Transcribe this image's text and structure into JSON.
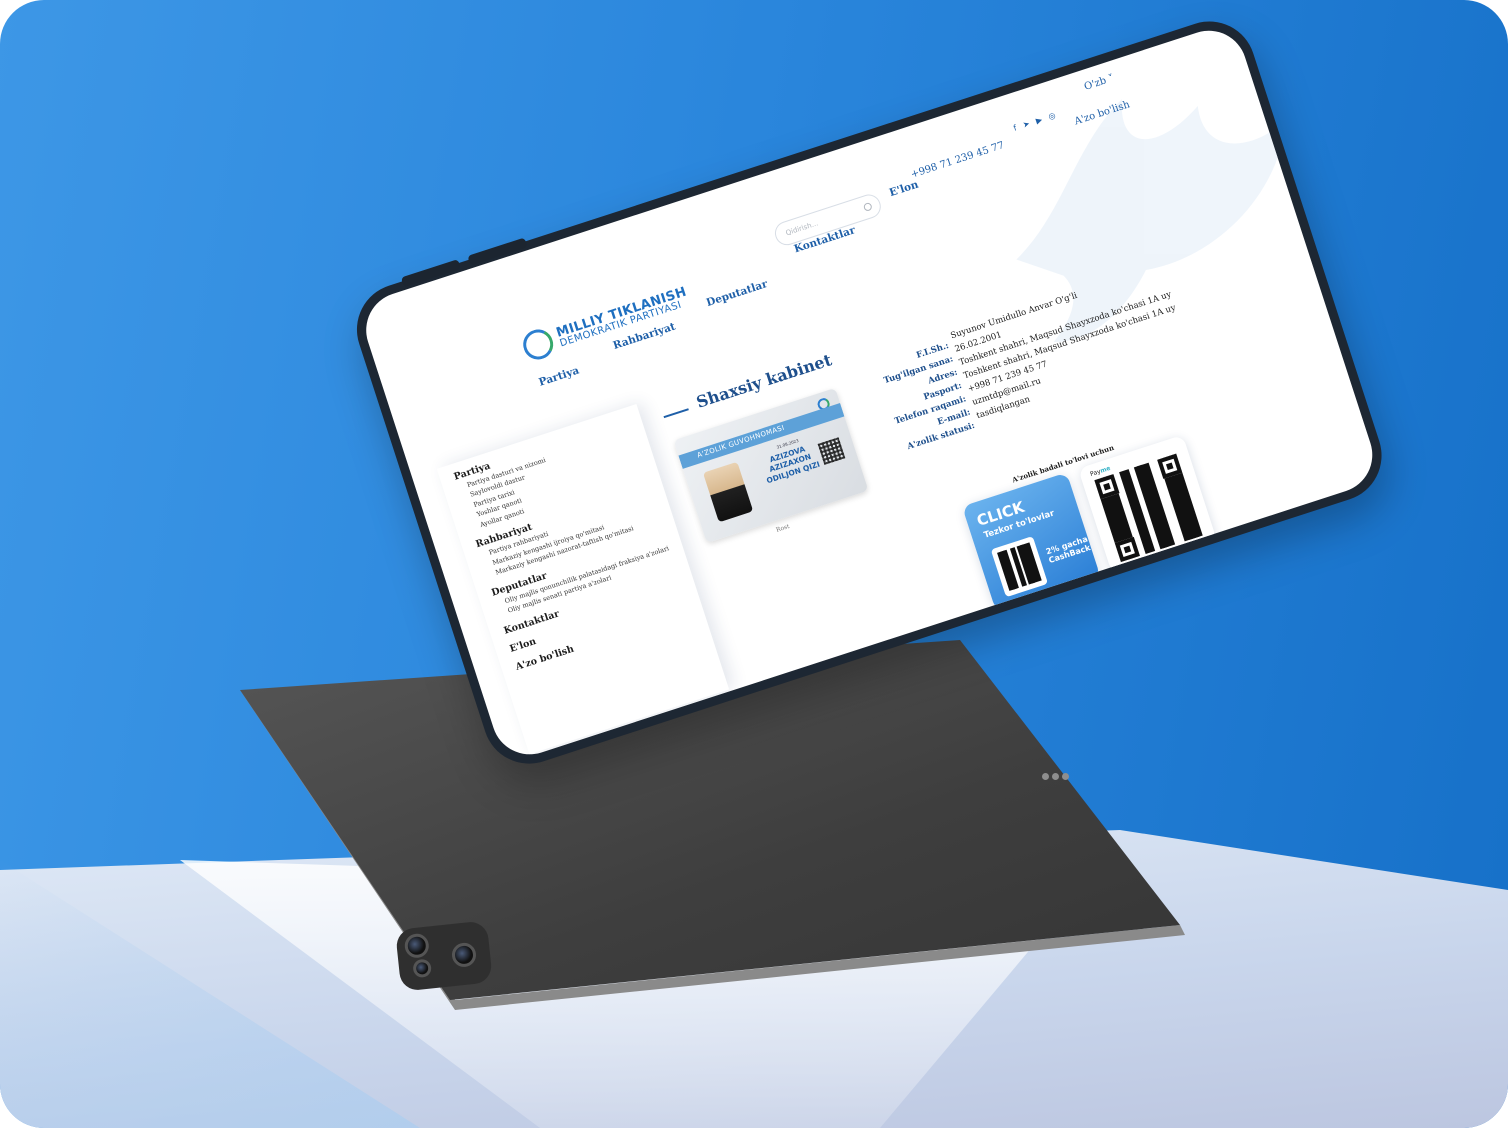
{
  "header": {
    "logo_line1": "MILLIY TIKLANISH",
    "logo_line2": "DEMOKRATIK PARTIYASI",
    "search_placeholder": "Qidirish...",
    "phone": "+998 71 239 45 77",
    "language": "O'zb ˅",
    "join_button": "A'zo bo'lish",
    "socials": [
      "facebook-icon",
      "telegram-icon",
      "youtube-icon",
      "instagram-icon"
    ]
  },
  "nav": {
    "items": [
      "Partiya",
      "Rahbariyat",
      "Deputatlar",
      "Kontaktlar",
      "E'lon"
    ]
  },
  "sidebar": {
    "groups": [
      {
        "title": "Partiya",
        "items": [
          "Partiya dasturi va nizomi",
          "Saylovoldi dastur",
          "Partiya tarixi",
          "Yoshlar qanoti",
          "Ayollar qanoti"
        ]
      },
      {
        "title": "Rahbariyat",
        "items": [
          "Partiya rahbariyati",
          "Markaziy kengashi ijroiya qo'mitasi",
          "Markaziy kengashi nazorat-taftish qo'mitasi"
        ]
      },
      {
        "title": "Deputatlar",
        "items": [
          "Oliy majlis qonunchilik palatasidagi fraksiya a'zolari",
          "Oliy majlis senati partiya a'zolari"
        ]
      },
      {
        "title": "Kontaktlar",
        "items": []
      },
      {
        "title": "E'lon",
        "items": []
      },
      {
        "title": "A'zo bo'lish",
        "items": []
      }
    ]
  },
  "main": {
    "title": "Shaxsiy kabinet",
    "card": {
      "band": "A'ZOLIK GUVOHNOMASI",
      "date": "31.08.2023",
      "name_line1": "AZIZOVA AZIZAXON",
      "name_line2": "ODILJON QIZI",
      "caption": "Rost"
    },
    "info": [
      {
        "label": "F.I.Sh.:",
        "value": "Suyunov Umidullo Anvar O'g'li"
      },
      {
        "label": "Tug'ilgan sana:",
        "value": "26.02.2001"
      },
      {
        "label": "Adres:",
        "value": "Toshkent shahri, Maqsud Shayxzoda ko'chasi 1A uy"
      },
      {
        "label": "Pasport:",
        "value": "Toshkent shahri, Maqsud Shayxzoda ko'chasi 1A uy"
      },
      {
        "label": "Telefon raqami:",
        "value": "+998 71 239 45 77"
      },
      {
        "label": "E-mail:",
        "value": "uzmtdp@mail.ru"
      },
      {
        "label": "A'zolik statusi:",
        "value": "tasdiqlangan"
      }
    ],
    "payment": {
      "title": "A'zolik badali to'lovi uchun",
      "click_logo": "CLICK",
      "click_sub": "Tezkor to'lovlar",
      "click_cashback_1": "2% gacha",
      "click_cashback_2": "CashBack",
      "payme_1": "Pay",
      "payme_2": "me"
    }
  }
}
